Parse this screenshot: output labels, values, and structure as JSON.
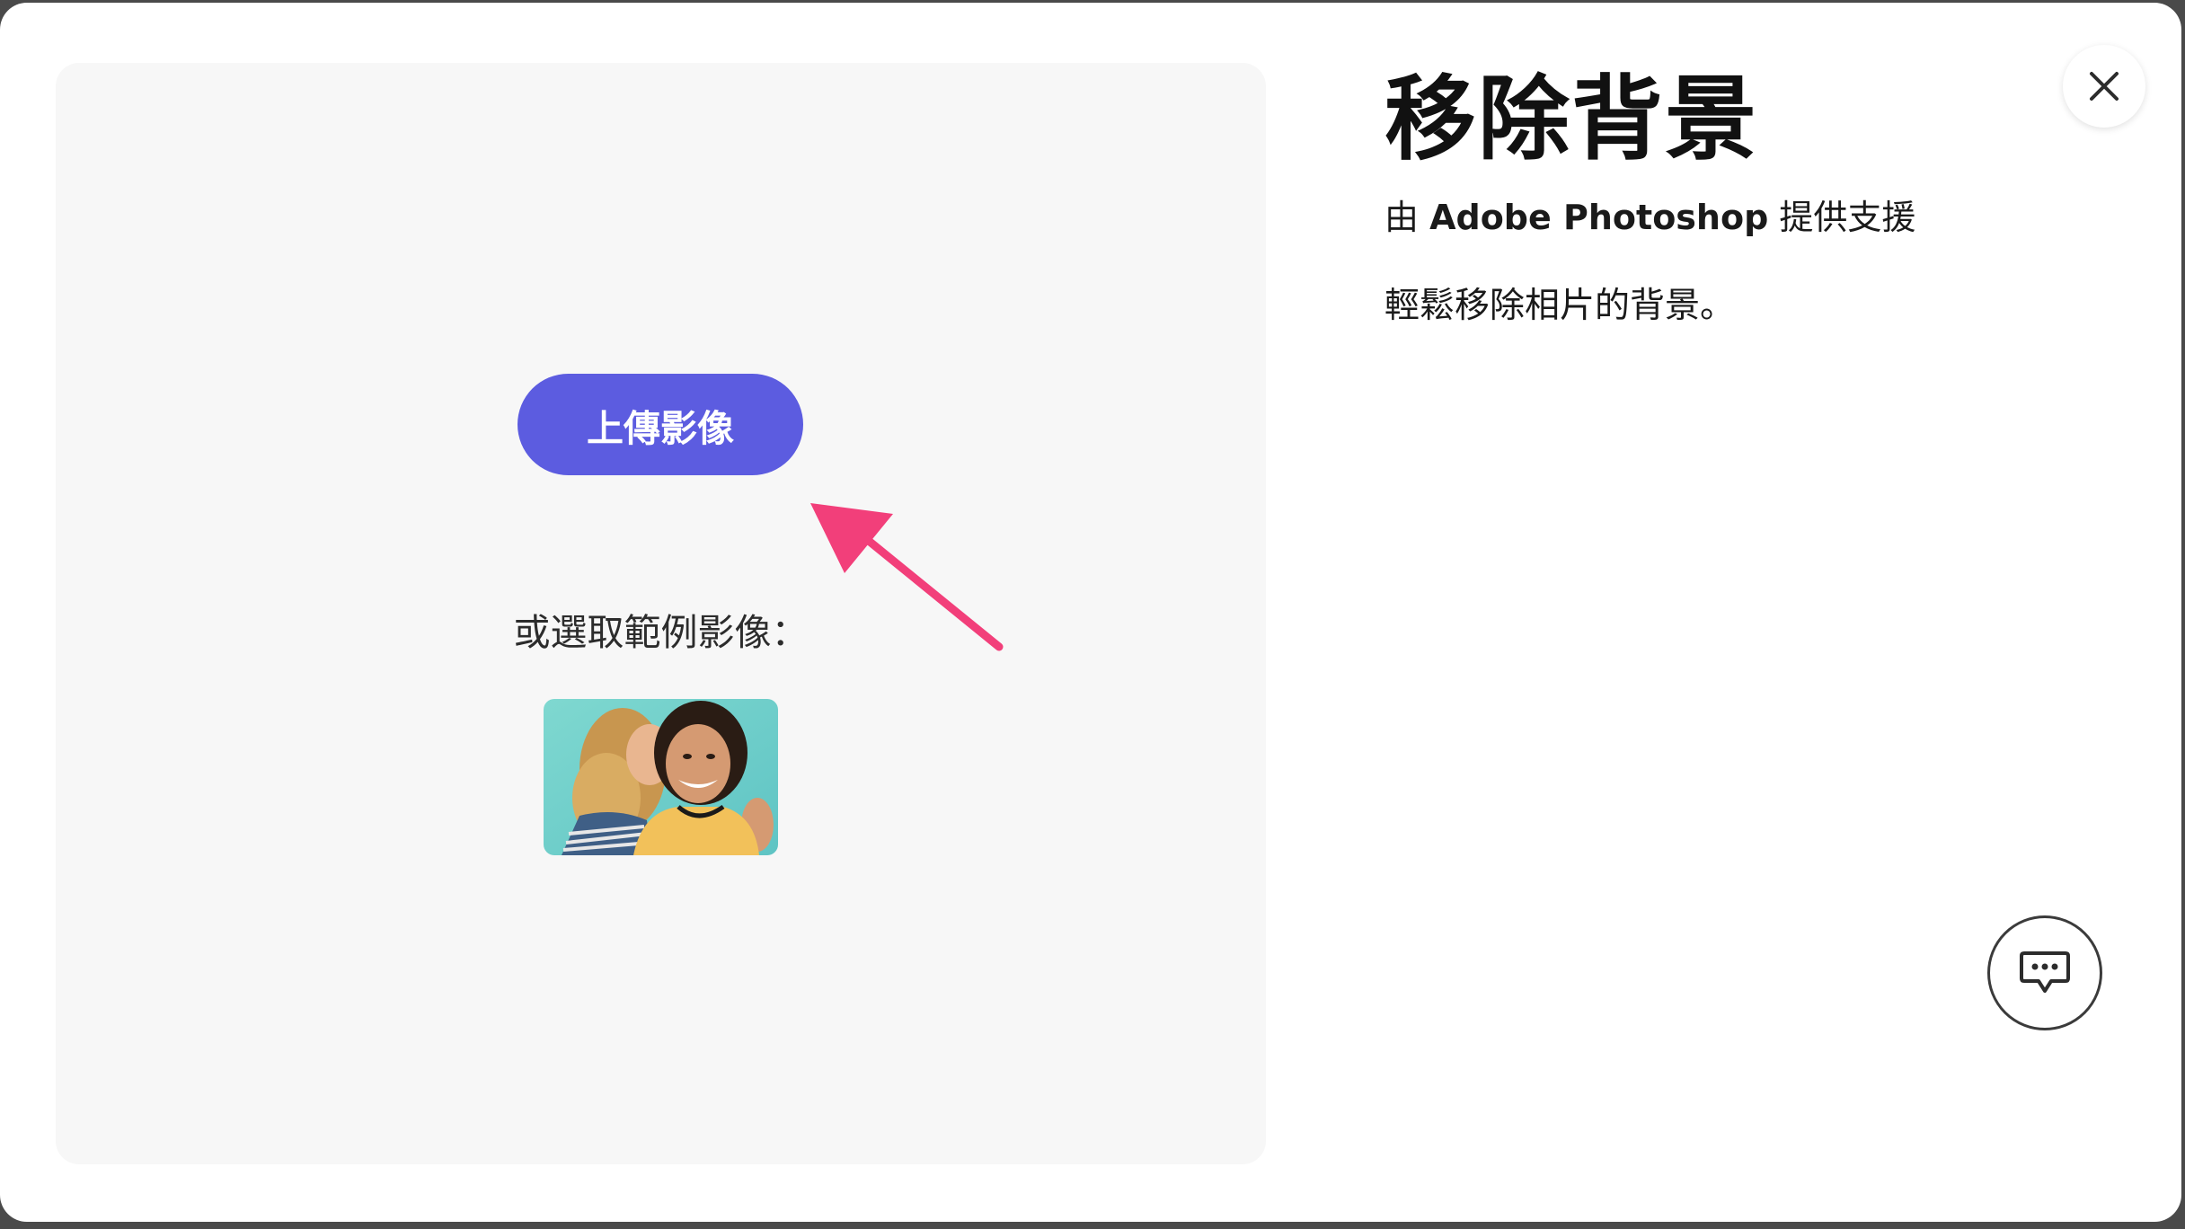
{
  "dialog": {
    "title": "移除背景",
    "powered_by_prefix": "由 ",
    "powered_by_brand": "Adobe Photoshop",
    "powered_by_suffix": " 提供支援",
    "description": "輕鬆移除相片的背景。"
  },
  "upload": {
    "button_label": "上傳影像"
  },
  "samples": {
    "label": "或選取範例影像："
  },
  "icons": {
    "close": "close-icon",
    "chat": "chat-icon",
    "annotation": "pointer-arrow-icon"
  },
  "colors": {
    "accent": "#5c5ce0",
    "annotation_arrow": "#f23f7a",
    "panel_bg": "#f7f7f7"
  }
}
